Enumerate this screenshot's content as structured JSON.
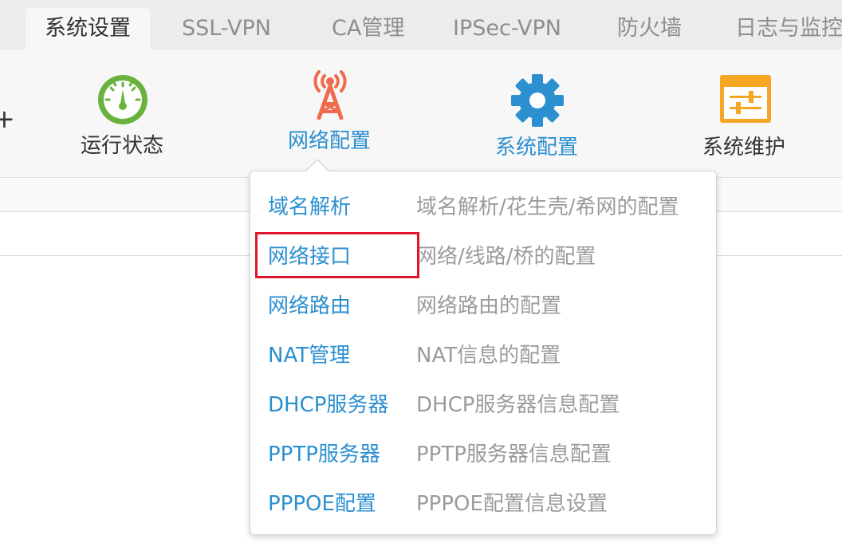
{
  "tabs": [
    {
      "label": "系统设置",
      "active": true
    },
    {
      "label": "SSL-VPN"
    },
    {
      "label": "CA管理"
    },
    {
      "label": "IPSec-VPN"
    },
    {
      "label": "防火墙"
    },
    {
      "label": "日志与监控"
    }
  ],
  "toolbar": {
    "items": [
      {
        "label": "运行状态",
        "icon": "gauge-icon",
        "color": "#6ab23e"
      },
      {
        "label": "网络配置",
        "icon": "antenna-tower-icon",
        "color": "#f06a4d"
      },
      {
        "label": "系统配置",
        "icon": "gear-icon",
        "color": "#2b8fd0"
      },
      {
        "label": "系统维护",
        "icon": "sliders-icon",
        "color": "#f5a623"
      }
    ]
  },
  "menu": {
    "items": [
      {
        "name": "域名解析",
        "desc": "域名解析/花生壳/希网的配置"
      },
      {
        "name": "网络接口",
        "desc": "网络/线路/桥的配置"
      },
      {
        "name": "网络路由",
        "desc": "网络路由的配置"
      },
      {
        "name": "NAT管理",
        "desc": "NAT信息的配置"
      },
      {
        "name": "DHCP服务器",
        "desc": "DHCP服务器信息配置"
      },
      {
        "name": "PPTP服务器",
        "desc": "PPTP服务器信息配置"
      },
      {
        "name": "PPPOE配置",
        "desc": "PPPOE配置信息设置"
      }
    ]
  },
  "colors": {
    "link_blue": "#2b8fd0",
    "highlight_red": "#e0142a"
  }
}
